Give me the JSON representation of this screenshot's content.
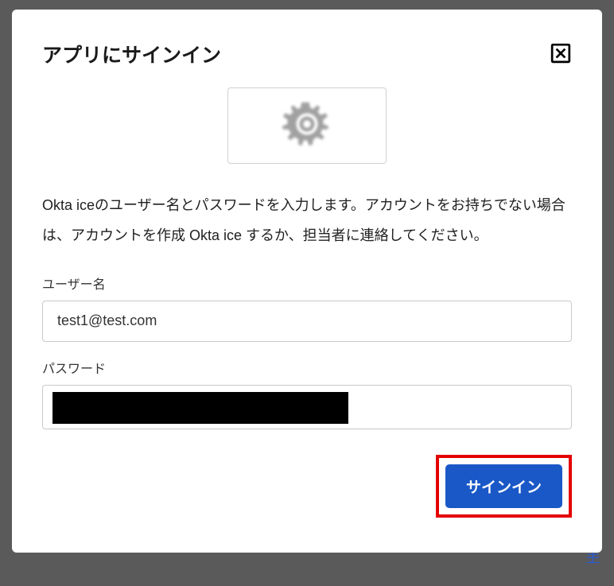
{
  "modal": {
    "title": "アプリにサインイン",
    "app_icon": "gear-icon",
    "description": "Okta iceのユーザー名とパスワードを入力します。アカウントをお持ちでない場合は、アカウントを作成 Okta ice するか、担当者に連絡してください。",
    "fields": {
      "username": {
        "label": "ユーザー名",
        "value": "test1@test.com"
      },
      "password": {
        "label": "パスワード",
        "value": "●●●●●●●●●●●●●●●●●●●●"
      }
    },
    "buttons": {
      "signin": "サインイン"
    }
  },
  "background": {
    "link_fragment": "手"
  }
}
